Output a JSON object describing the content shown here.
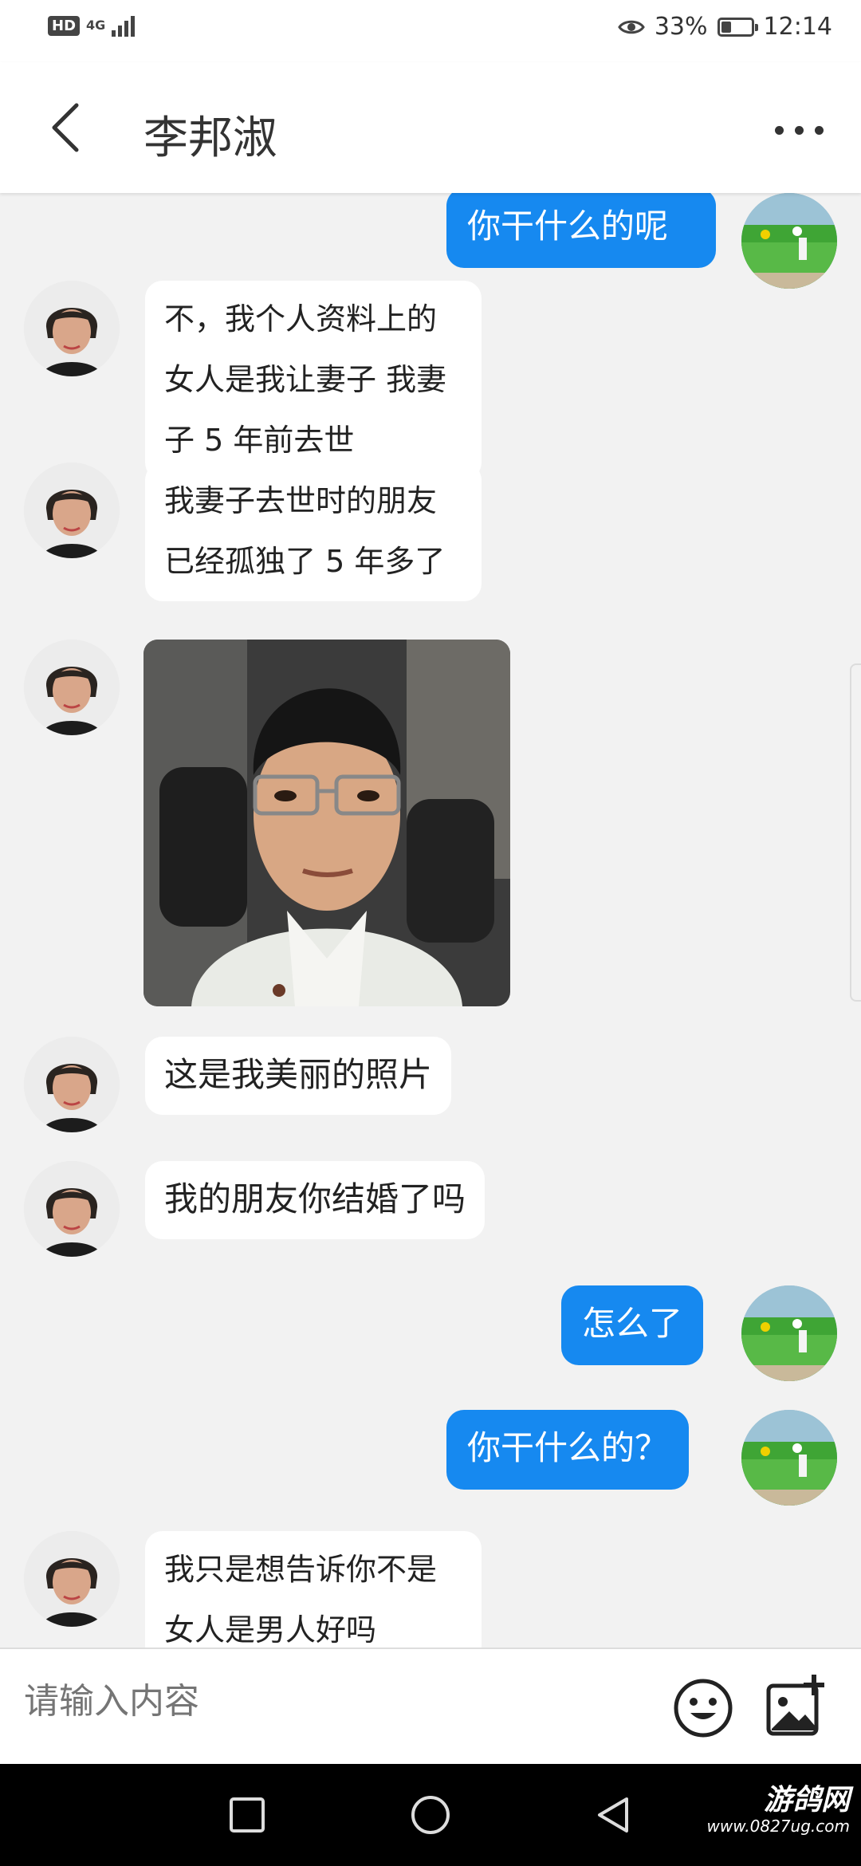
{
  "status_bar": {
    "hd": "HD",
    "network": "4G",
    "battery_percent": "33%",
    "battery_level": 0.33,
    "time": "12:14"
  },
  "header": {
    "title": "李邦淑",
    "back_icon": "chevron-left-icon",
    "more_icon": "more-horizontal-icon"
  },
  "messages": [
    {
      "from": "me",
      "text": "你干什么的呢"
    },
    {
      "from": "her",
      "text": "不，我个人资料上的女人是我让妻子 我妻子 5 年前去世"
    },
    {
      "from": "her",
      "text": "我妻子去世时的朋友已经孤独了 5 年多了"
    },
    {
      "from": "her",
      "type": "image"
    },
    {
      "from": "her",
      "text": "这是我美丽的照片"
    },
    {
      "from": "her",
      "text": "我的朋友你结婚了吗"
    },
    {
      "from": "me",
      "text": "怎么了"
    },
    {
      "from": "me",
      "text": "你干什么的？"
    },
    {
      "from": "her",
      "text": "我只是想告诉你不是女人是男人好吗"
    }
  ],
  "input": {
    "placeholder": "请输入内容",
    "emoji_icon": "smiley-icon",
    "image_icon": "add-image-icon"
  },
  "watermark": {
    "brand": "游鸽网",
    "url": "www.0827ug.com"
  },
  "colors": {
    "outgoing_bubble": "#1689f0",
    "incoming_bubble": "#ffffff",
    "chat_background": "#f2f2f2"
  }
}
